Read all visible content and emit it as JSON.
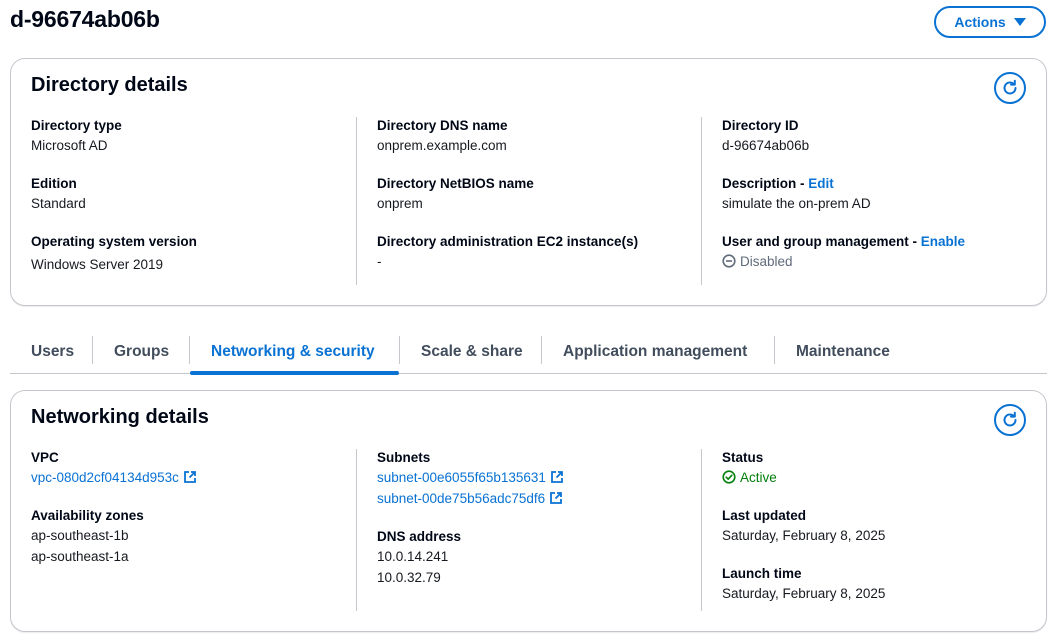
{
  "header": {
    "title": "d-96674ab06b",
    "actions_label": "Actions"
  },
  "directory_details": {
    "title": "Directory details",
    "directory_type": {
      "label": "Directory type",
      "value": "Microsoft AD"
    },
    "edition": {
      "label": "Edition",
      "value": "Standard"
    },
    "os_version": {
      "label": "Operating system version",
      "value": "Windows Server 2019"
    },
    "dns_name": {
      "label": "Directory DNS name",
      "value": "onprem.example.com"
    },
    "netbios_name": {
      "label": "Directory NetBIOS name",
      "value": "onprem"
    },
    "admin_instances": {
      "label": "Directory administration EC2 instance(s)",
      "value": "-"
    },
    "directory_id": {
      "label": "Directory ID",
      "value": "d-96674ab06b"
    },
    "description": {
      "label": "Description - ",
      "link": "Edit",
      "value": "simulate the on-prem AD"
    },
    "user_group_mgmt": {
      "label": "User and group management - ",
      "link": "Enable",
      "value": "Disabled"
    }
  },
  "tabs": [
    {
      "label": "Users"
    },
    {
      "label": "Groups"
    },
    {
      "label": "Networking & security",
      "active": true
    },
    {
      "label": "Scale & share"
    },
    {
      "label": "Application management"
    },
    {
      "label": "Maintenance"
    }
  ],
  "networking_details": {
    "title": "Networking details",
    "vpc": {
      "label": "VPC",
      "value": "vpc-080d2cf04134d953c"
    },
    "availability_zones": {
      "label": "Availability zones",
      "values": [
        "ap-southeast-1b",
        "ap-southeast-1a"
      ]
    },
    "subnets": {
      "label": "Subnets",
      "values": [
        "subnet-00e6055f65b135631",
        "subnet-00de75b56adc75df6"
      ]
    },
    "dns_address": {
      "label": "DNS address",
      "values": [
        "10.0.14.241",
        "10.0.32.79"
      ]
    },
    "status": {
      "label": "Status",
      "value": "Active"
    },
    "last_updated": {
      "label": "Last updated",
      "value": "Saturday, February 8, 2025"
    },
    "launch_time": {
      "label": "Launch time",
      "value": "Saturday, February 8, 2025"
    }
  },
  "icons": {
    "refresh": "refresh-icon",
    "external_link": "external-link-icon",
    "status_disabled": "minus-circle-icon",
    "status_active": "check-circle-icon",
    "caret": "caret-down-icon"
  },
  "colors": {
    "link": "#0972d3",
    "active": "#037f0c",
    "disabled": "#5f6b7a",
    "border": "#c6c6cd"
  }
}
